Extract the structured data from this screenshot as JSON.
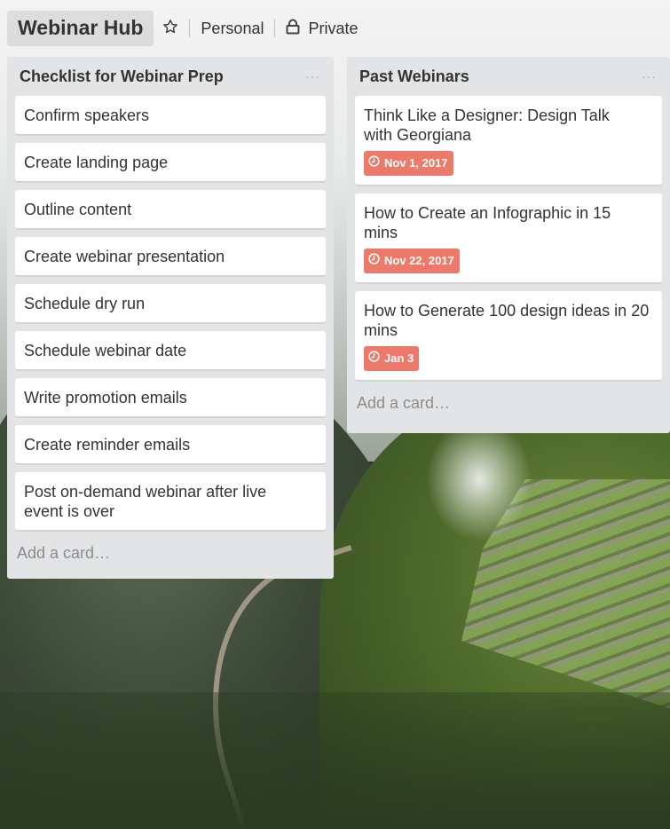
{
  "board": {
    "title": "Webinar Hub",
    "team_label": "Personal",
    "visibility_label": "Private"
  },
  "icons": {
    "star": "star-icon",
    "lock": "lock-icon",
    "clock": "clock-icon",
    "menu": "ellipsis-icon"
  },
  "colors": {
    "list_bg": "#e2e4e6",
    "due_badge": "#eb7a6a"
  },
  "lists": [
    {
      "title": "Checklist for Webinar Prep",
      "menu": "···",
      "cards": [
        {
          "title": "Confirm speakers"
        },
        {
          "title": "Create landing page"
        },
        {
          "title": "Outline content"
        },
        {
          "title": "Create webinar presentation"
        },
        {
          "title": "Schedule dry run"
        },
        {
          "title": "Schedule webinar date"
        },
        {
          "title": "Write promotion emails"
        },
        {
          "title": "Create reminder emails"
        },
        {
          "title": "Post on-demand webinar after live event is over"
        }
      ],
      "add_card": "Add a card…"
    },
    {
      "title": "Past Webinars",
      "menu": "···",
      "cards": [
        {
          "title": "Think Like a Designer: Design Talk with Georgiana",
          "due": "Nov 1, 2017"
        },
        {
          "title": "How to Create an Infographic in 15 mins",
          "due": "Nov 22, 2017"
        },
        {
          "title": "How to Generate 100 design ideas in 20 mins",
          "due": "Jan 3"
        }
      ],
      "add_card": "Add a card…"
    }
  ]
}
